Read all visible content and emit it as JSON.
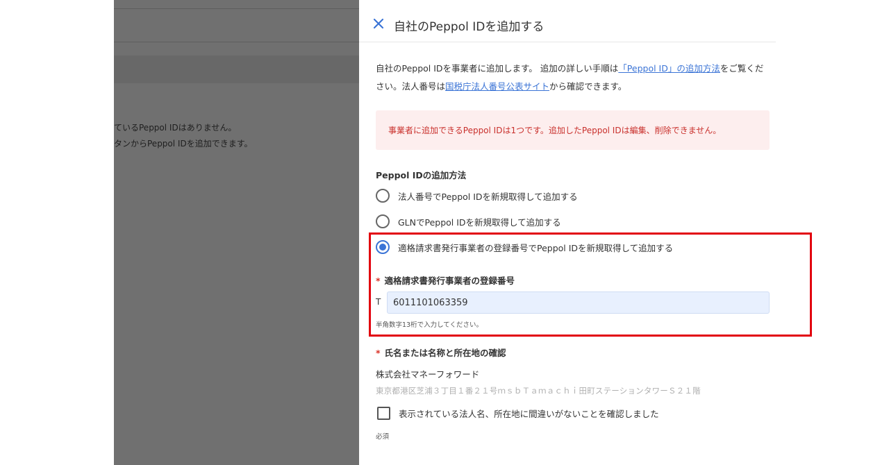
{
  "background": {
    "line1": "ているPeppol IDはありません。",
    "line2": "タンからPeppol IDを追加できます。"
  },
  "drawer": {
    "title": "自社のPeppol IDを追加する",
    "intro": {
      "part1": "自社のPeppol IDを事業者に追加します。 追加の詳しい手順は",
      "link1": "「Peppol ID」の追加方法",
      "part2": "をご覧ください。法人番号は",
      "link2": "国税庁法人番号公表サイト",
      "part3": "から確認できます。"
    },
    "alert": "事業者に追加できるPeppol IDは1つです。追加したPeppol IDは編集、削除できません。",
    "method_label": "Peppol IDの追加方法",
    "methods": [
      {
        "label": "法人番号でPeppol IDを新規取得して追加する",
        "checked": false
      },
      {
        "label": "GLNでPeppol IDを新規取得して追加する",
        "checked": false
      },
      {
        "label": "適格請求書発行事業者の登録番号でPeppol IDを新規取得して追加する",
        "checked": true
      }
    ],
    "registration": {
      "label": "適格請求書発行事業者の登録番号",
      "required_mark": "*",
      "prefix": "T",
      "value": "6011101063359",
      "hint": "半角数字13桁で入力してください。"
    },
    "confirm": {
      "label": "氏名または名称と所在地の確認",
      "required_mark": "*",
      "company_name": "株式会社マネーフォワード",
      "address": "東京都港区芝浦３丁目１番２１号ｍｓｂＴａｍａｃｈｉ田町ステーションタワーＳ２１階",
      "checkbox_label": "表示されている法人名、所在地に間違いがないことを確認しました",
      "required_note": "必須"
    }
  },
  "colors": {
    "accent": "#3b74d6",
    "alert_bg": "#fdeeee",
    "alert_text": "#c9302c",
    "highlight": "#e2000e",
    "overlay": "#707070"
  }
}
